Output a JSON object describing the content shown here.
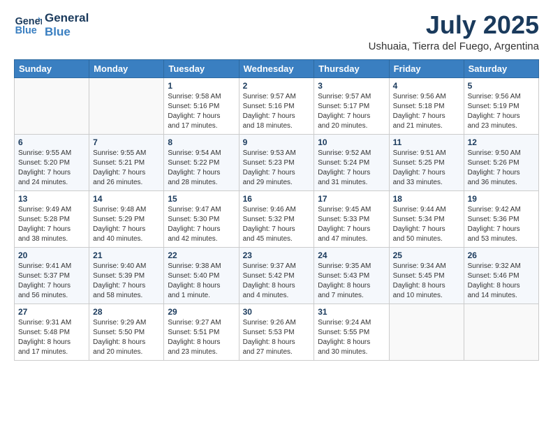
{
  "header": {
    "logo_general": "General",
    "logo_blue": "Blue",
    "month_year": "July 2025",
    "location": "Ushuaia, Tierra del Fuego, Argentina"
  },
  "weekdays": [
    "Sunday",
    "Monday",
    "Tuesday",
    "Wednesday",
    "Thursday",
    "Friday",
    "Saturday"
  ],
  "weeks": [
    [
      {
        "day": "",
        "info": ""
      },
      {
        "day": "",
        "info": ""
      },
      {
        "day": "1",
        "info": "Sunrise: 9:58 AM\nSunset: 5:16 PM\nDaylight: 7 hours\nand 17 minutes."
      },
      {
        "day": "2",
        "info": "Sunrise: 9:57 AM\nSunset: 5:16 PM\nDaylight: 7 hours\nand 18 minutes."
      },
      {
        "day": "3",
        "info": "Sunrise: 9:57 AM\nSunset: 5:17 PM\nDaylight: 7 hours\nand 20 minutes."
      },
      {
        "day": "4",
        "info": "Sunrise: 9:56 AM\nSunset: 5:18 PM\nDaylight: 7 hours\nand 21 minutes."
      },
      {
        "day": "5",
        "info": "Sunrise: 9:56 AM\nSunset: 5:19 PM\nDaylight: 7 hours\nand 23 minutes."
      }
    ],
    [
      {
        "day": "6",
        "info": "Sunrise: 9:55 AM\nSunset: 5:20 PM\nDaylight: 7 hours\nand 24 minutes."
      },
      {
        "day": "7",
        "info": "Sunrise: 9:55 AM\nSunset: 5:21 PM\nDaylight: 7 hours\nand 26 minutes."
      },
      {
        "day": "8",
        "info": "Sunrise: 9:54 AM\nSunset: 5:22 PM\nDaylight: 7 hours\nand 28 minutes."
      },
      {
        "day": "9",
        "info": "Sunrise: 9:53 AM\nSunset: 5:23 PM\nDaylight: 7 hours\nand 29 minutes."
      },
      {
        "day": "10",
        "info": "Sunrise: 9:52 AM\nSunset: 5:24 PM\nDaylight: 7 hours\nand 31 minutes."
      },
      {
        "day": "11",
        "info": "Sunrise: 9:51 AM\nSunset: 5:25 PM\nDaylight: 7 hours\nand 33 minutes."
      },
      {
        "day": "12",
        "info": "Sunrise: 9:50 AM\nSunset: 5:26 PM\nDaylight: 7 hours\nand 36 minutes."
      }
    ],
    [
      {
        "day": "13",
        "info": "Sunrise: 9:49 AM\nSunset: 5:28 PM\nDaylight: 7 hours\nand 38 minutes."
      },
      {
        "day": "14",
        "info": "Sunrise: 9:48 AM\nSunset: 5:29 PM\nDaylight: 7 hours\nand 40 minutes."
      },
      {
        "day": "15",
        "info": "Sunrise: 9:47 AM\nSunset: 5:30 PM\nDaylight: 7 hours\nand 42 minutes."
      },
      {
        "day": "16",
        "info": "Sunrise: 9:46 AM\nSunset: 5:32 PM\nDaylight: 7 hours\nand 45 minutes."
      },
      {
        "day": "17",
        "info": "Sunrise: 9:45 AM\nSunset: 5:33 PM\nDaylight: 7 hours\nand 47 minutes."
      },
      {
        "day": "18",
        "info": "Sunrise: 9:44 AM\nSunset: 5:34 PM\nDaylight: 7 hours\nand 50 minutes."
      },
      {
        "day": "19",
        "info": "Sunrise: 9:42 AM\nSunset: 5:36 PM\nDaylight: 7 hours\nand 53 minutes."
      }
    ],
    [
      {
        "day": "20",
        "info": "Sunrise: 9:41 AM\nSunset: 5:37 PM\nDaylight: 7 hours\nand 56 minutes."
      },
      {
        "day": "21",
        "info": "Sunrise: 9:40 AM\nSunset: 5:39 PM\nDaylight: 7 hours\nand 58 minutes."
      },
      {
        "day": "22",
        "info": "Sunrise: 9:38 AM\nSunset: 5:40 PM\nDaylight: 8 hours\nand 1 minute."
      },
      {
        "day": "23",
        "info": "Sunrise: 9:37 AM\nSunset: 5:42 PM\nDaylight: 8 hours\nand 4 minutes."
      },
      {
        "day": "24",
        "info": "Sunrise: 9:35 AM\nSunset: 5:43 PM\nDaylight: 8 hours\nand 7 minutes."
      },
      {
        "day": "25",
        "info": "Sunrise: 9:34 AM\nSunset: 5:45 PM\nDaylight: 8 hours\nand 10 minutes."
      },
      {
        "day": "26",
        "info": "Sunrise: 9:32 AM\nSunset: 5:46 PM\nDaylight: 8 hours\nand 14 minutes."
      }
    ],
    [
      {
        "day": "27",
        "info": "Sunrise: 9:31 AM\nSunset: 5:48 PM\nDaylight: 8 hours\nand 17 minutes."
      },
      {
        "day": "28",
        "info": "Sunrise: 9:29 AM\nSunset: 5:50 PM\nDaylight: 8 hours\nand 20 minutes."
      },
      {
        "day": "29",
        "info": "Sunrise: 9:27 AM\nSunset: 5:51 PM\nDaylight: 8 hours\nand 23 minutes."
      },
      {
        "day": "30",
        "info": "Sunrise: 9:26 AM\nSunset: 5:53 PM\nDaylight: 8 hours\nand 27 minutes."
      },
      {
        "day": "31",
        "info": "Sunrise: 9:24 AM\nSunset: 5:55 PM\nDaylight: 8 hours\nand 30 minutes."
      },
      {
        "day": "",
        "info": ""
      },
      {
        "day": "",
        "info": ""
      }
    ]
  ]
}
